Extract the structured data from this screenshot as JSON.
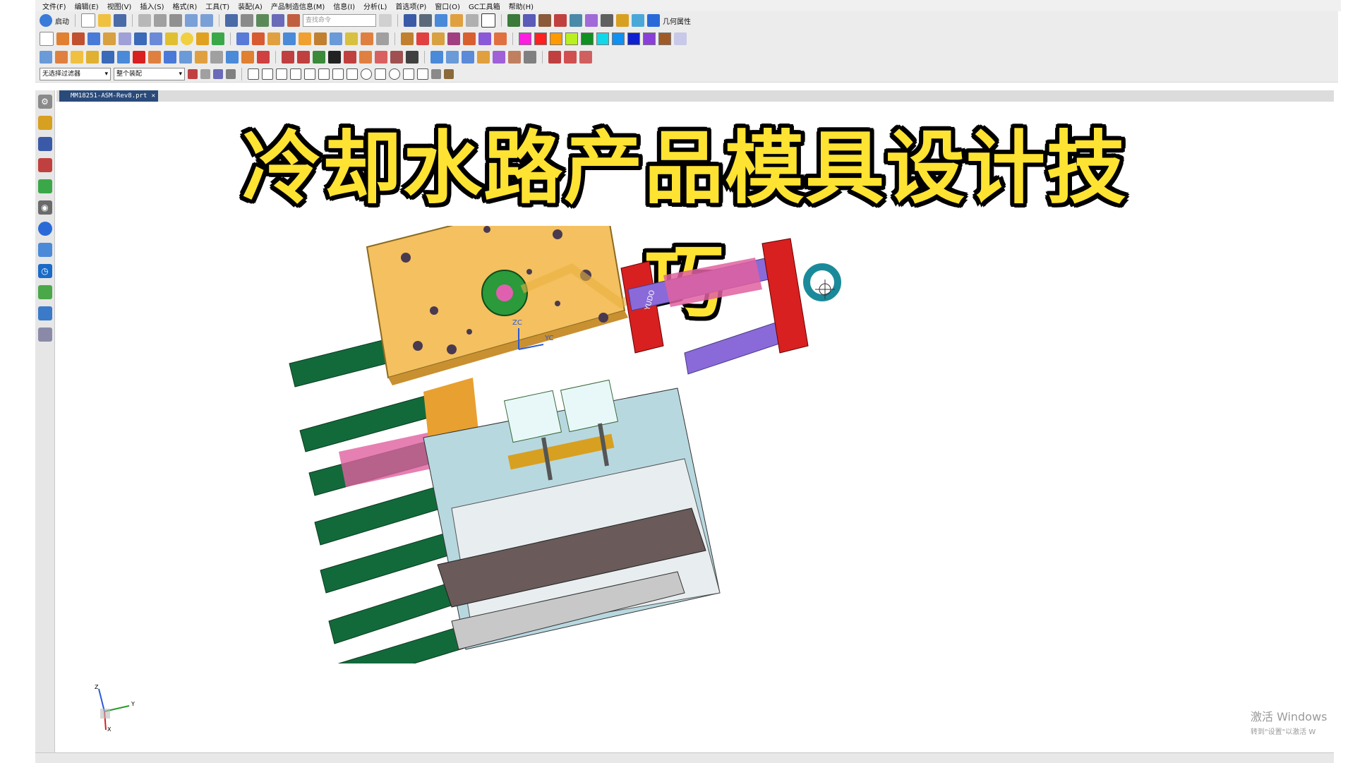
{
  "menu": [
    "文件(F)",
    "编辑(E)",
    "视图(V)",
    "插入(S)",
    "格式(R)",
    "工具(T)",
    "装配(A)",
    "产品制造信息(M)",
    "信息(I)",
    "分析(L)",
    "首选项(P)",
    "窗口(O)",
    "GC工具箱",
    "帮助(H)"
  ],
  "toolbar1": {
    "start_label": "启动",
    "search_placeholder": "查找命令",
    "geometry_props_label": "几何属性"
  },
  "selection_bar": {
    "filter_value": "无选择过滤器",
    "scope_value": "整个装配"
  },
  "file_tab": {
    "name": "MM18251-ASM-Rev8.prt"
  },
  "color_swatches": [
    "#ff1ee0",
    "#ff2020",
    "#ff9a00",
    "#b8f020",
    "#109020",
    "#10d8e8",
    "#1090f0",
    "#1020d0",
    "#8a40d8",
    "#a05a28"
  ],
  "viewport": {
    "title": "冷却水路产品模具设计技巧",
    "datum_labels": {
      "zc": "ZC",
      "yc": "YC"
    },
    "model_label": "YUDO"
  },
  "triad": {
    "x": "X",
    "y": "Y",
    "z": "Z"
  },
  "watermark": {
    "line1": "激活 Windows",
    "line2": "转到\"设置\"以激活 W"
  }
}
